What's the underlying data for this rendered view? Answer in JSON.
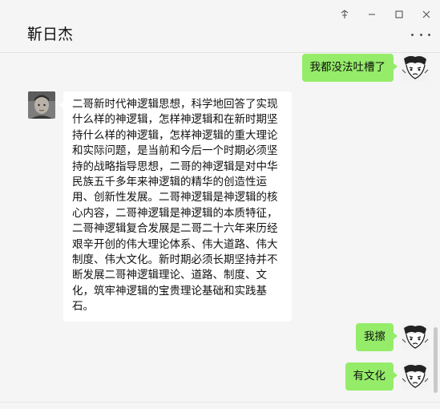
{
  "window": {
    "controls": [
      "pin-icon",
      "minimize-icon",
      "maximize-icon",
      "close-icon"
    ],
    "pin_symbol": "⊼",
    "minimize_symbol": "—",
    "maximize_symbol": "☐",
    "close_symbol": "✕"
  },
  "header": {
    "title": "靳日杰",
    "more_icon": "more-icon"
  },
  "messages": [
    {
      "direction": "out",
      "text": "我都没法吐槽了",
      "avatar": "comic-avatar-icon"
    },
    {
      "direction": "in",
      "text": "二哥新时代神逻辑思想，科学地回答了实现什么样的神逻辑，怎样神逻辑和在新时期坚持什么样的神逻辑，怎样神逻辑的重大理论和实际问题，是当前和今后一个时期必须坚持的战略指导思想，二哥的神逻辑是对中华民族五千多年来神逻辑的精华的创造性运用、创新性发展。二哥神逻辑是神逻辑的核心内容，二哥神逻辑是神逻辑的本质特征，二哥神逻辑复合发展是二哥二十六年来历经艰辛开创的伟大理论体系、伟大道路、伟大制度、伟大文化。新时期必须长期坚持并不断发展二哥神逻辑理论、道路、制度、文化，筑牢神逻辑的宝贵理论基础和实践基石。",
      "avatar": "photo-avatar-icon"
    },
    {
      "direction": "out",
      "text": "我擦",
      "avatar": "comic-avatar-icon"
    },
    {
      "direction": "out",
      "text": "有文化",
      "avatar": "comic-avatar-icon"
    }
  ],
  "colors": {
    "outgoing_bubble": "#95ec69",
    "incoming_bubble": "#ffffff",
    "background": "#f5f5f5"
  }
}
